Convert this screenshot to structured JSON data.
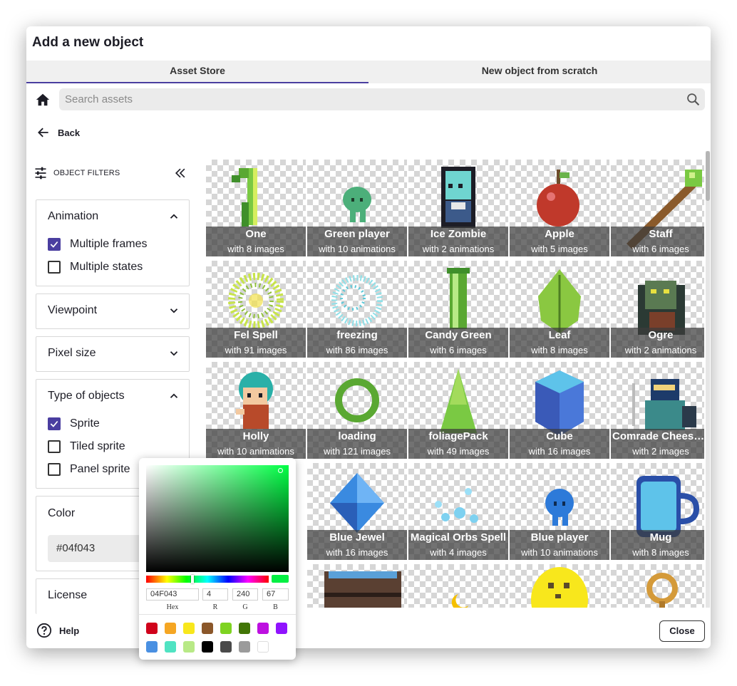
{
  "dialog": {
    "title": "Add a new object",
    "tabs": [
      "Asset Store",
      "New object from scratch"
    ],
    "active_tab": "Asset Store",
    "search_placeholder": "Search assets",
    "back_label": "Back",
    "help_label": "Help",
    "close_label": "Close"
  },
  "filters": {
    "header": "OBJECT FILTERS",
    "animation": {
      "title": "Animation",
      "options": [
        {
          "label": "Multiple frames",
          "checked": true
        },
        {
          "label": "Multiple states",
          "checked": false
        }
      ]
    },
    "viewpoint": {
      "title": "Viewpoint"
    },
    "pixel_size": {
      "title": "Pixel size"
    },
    "type": {
      "title": "Type of objects",
      "options": [
        {
          "label": "Sprite",
          "checked": true
        },
        {
          "label": "Tiled sprite",
          "checked": false
        },
        {
          "label": "Panel sprite",
          "checked": false
        }
      ]
    },
    "color": {
      "title": "Color",
      "value": "#04f043"
    },
    "license": {
      "title": "License"
    }
  },
  "assets": [
    {
      "name": "One",
      "sub": "with 8 images",
      "icon": "one"
    },
    {
      "name": "Green player",
      "sub": "with 10 animations",
      "icon": "green-player"
    },
    {
      "name": "Ice Zombie",
      "sub": "with 2 animations",
      "icon": "ice-zombie"
    },
    {
      "name": "Apple",
      "sub": "with 5 images",
      "icon": "apple"
    },
    {
      "name": "Staff",
      "sub": "with 6 images",
      "icon": "staff"
    },
    {
      "name": "Fel Spell",
      "sub": "with 91 images",
      "icon": "fel-spell"
    },
    {
      "name": "freezing",
      "sub": "with 86 images",
      "icon": "freezing"
    },
    {
      "name": "Candy Green",
      "sub": "with 6 images",
      "icon": "candy-green"
    },
    {
      "name": "Leaf",
      "sub": "with 8 images",
      "icon": "leaf"
    },
    {
      "name": "Ogre",
      "sub": "with 2 animations",
      "icon": "ogre"
    },
    {
      "name": "Holly",
      "sub": "with 10 animations",
      "icon": "holly"
    },
    {
      "name": "loading",
      "sub": "with 121 images",
      "icon": "loading"
    },
    {
      "name": "foliagePack",
      "sub": "with 49 images",
      "icon": "foliage"
    },
    {
      "name": "Cube",
      "sub": "with 16 images",
      "icon": "cube"
    },
    {
      "name": "Comrade Cheese ...",
      "sub": "with 2 images",
      "icon": "comrade"
    },
    {
      "name": "",
      "sub": "",
      "icon": "hidden"
    },
    {
      "name": "Blue Jewel",
      "sub": "with 16 images",
      "icon": "jewel"
    },
    {
      "name": "Magical Orbs Spell",
      "sub": "with 4 images",
      "icon": "orbs"
    },
    {
      "name": "Blue player",
      "sub": "with 10 animations",
      "icon": "blue-player"
    },
    {
      "name": "Mug",
      "sub": "with 8 images",
      "icon": "mug"
    },
    {
      "name": "",
      "sub": "",
      "icon": "hidden"
    },
    {
      "name": "",
      "sub": "",
      "icon": "barrel"
    },
    {
      "name": "",
      "sub": "",
      "icon": "moon"
    },
    {
      "name": "",
      "sub": "",
      "icon": "cheese"
    },
    {
      "name": "",
      "sub": "",
      "icon": "ring"
    }
  ],
  "color_picker": {
    "hex": "04F043",
    "r": "4",
    "g": "240",
    "b": "67",
    "labels": [
      "Hex",
      "R",
      "G",
      "B"
    ],
    "swatches": [
      "#d0021b",
      "#f5a623",
      "#f8e71c",
      "#8b572a",
      "#7ed321",
      "#417505",
      "#bd10e0",
      "#9013fe",
      "#4a90e2",
      "#50e3c2",
      "#b8e986",
      "#000000",
      "#4a4a4a",
      "#9b9b9b",
      "#ffffff"
    ]
  }
}
